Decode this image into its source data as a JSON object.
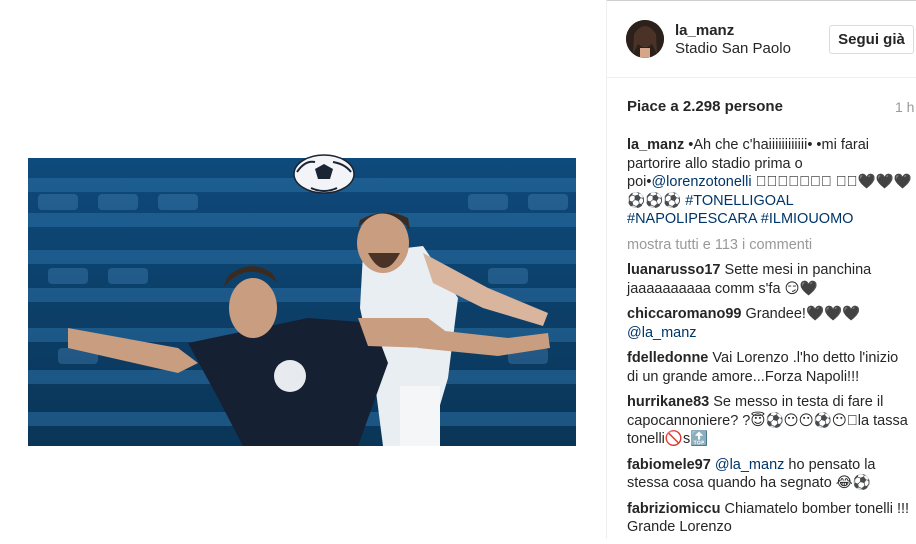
{
  "post": {
    "username": "la_manz",
    "location": "Stadio San Paolo",
    "follow_label": "Segui già",
    "likes_text": "Piace a 2.298 persone",
    "time_text": "1 h"
  },
  "caption": {
    "user": "la_manz",
    "text_1": " •Ah che c'haiiiiiiiiiiii• •mi farai partorire allo stadio prima o poi•",
    "mention": "@lorenzotonelli",
    "text_2": " 󾓬󾓬󾓬󾓬󾓬󾓬󾓬 󾓬󾓬🖤🖤🖤⚽⚽⚽ ",
    "hashtag_1": "#TONELLIGOAL",
    "hashtag_2": "#NAPOLIPESCARA",
    "hashtag_3": "#ILMIOUOMO"
  },
  "show_all_comments": "mostra tutti e 113 i commenti",
  "comments": [
    {
      "user": "luanarusso17",
      "text": " Sette mesi in panchina jaaaaaaaaaa comm s'fa 😏🖤"
    },
    {
      "user": "chiccaromano99",
      "text": " Grandee!🖤🖤🖤 ",
      "mention": "@la_manz"
    },
    {
      "user": "fdelledonne",
      "text": " Vai Lorenzo .l'ho detto l'inizio di un grande amore...Forza Napoli!!!"
    },
    {
      "user": "hurrikane83",
      "text": " Se messo in testa di fare il capocannoniere? ?😇⚽😶😶⚽😶󾓬la tassa tonelli🚫s🔝"
    },
    {
      "user": "fabiomele97",
      "mention": "@la_manz",
      "text": " ho pensato la stessa cosa quando ha segnato 😂⚽"
    },
    {
      "user": "fabriziomiccu",
      "text": " Chiamatelo bomber tonelli !!! Grande Lorenzo"
    }
  ],
  "colors": {
    "link": "#003569",
    "muted": "#999999",
    "photo_tint": "#0c3c66"
  },
  "icons": {
    "avatar": "profile-photo",
    "ball": "soccer-ball"
  }
}
